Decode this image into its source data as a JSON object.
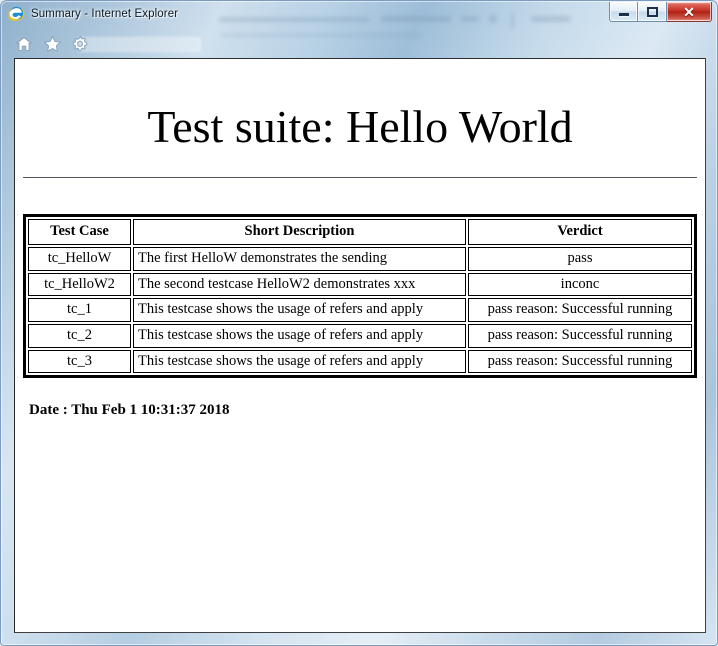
{
  "window": {
    "title": "Summary - Internet Explorer",
    "app_icon": "internet-explorer-logo",
    "controls": {
      "minimize_label": "Minimize",
      "maximize_label": "Maximize",
      "close_label": "Close",
      "close_glyph": "✕"
    }
  },
  "toolbar": {
    "items": [
      {
        "name": "home-icon",
        "label": "Home"
      },
      {
        "name": "favorites-star-icon",
        "label": "Favorites"
      },
      {
        "name": "gear-icon",
        "label": "Tools"
      }
    ]
  },
  "page": {
    "title": "Test suite: Hello World",
    "date_line": "Date : Thu Feb 1 10:31:37 2018",
    "table": {
      "headers": [
        "Test Case",
        "Short Description",
        "Verdict"
      ],
      "rows": [
        {
          "case": "tc_HelloW",
          "description": "The first HelloW demonstrates the sending",
          "verdict": "pass"
        },
        {
          "case": "tc_HelloW2",
          "description": "The second testcase HelloW2 demonstrates xxx",
          "verdict": "inconc"
        },
        {
          "case": "tc_1",
          "description": "This testcase shows the usage of refers and apply",
          "verdict": "pass reason: Successful running"
        },
        {
          "case": "tc_2",
          "description": "This testcase shows the usage of refers and apply",
          "verdict": "pass reason: Successful running"
        },
        {
          "case": "tc_3",
          "description": "This testcase shows the usage of refers and apply",
          "verdict": "pass reason: Successful running"
        }
      ]
    }
  },
  "colors": {
    "frame_blue": "#a9c4da",
    "close_red": "#c32c20",
    "page_background": "#ffffff",
    "text": "#000000",
    "rule": "#55555d"
  }
}
